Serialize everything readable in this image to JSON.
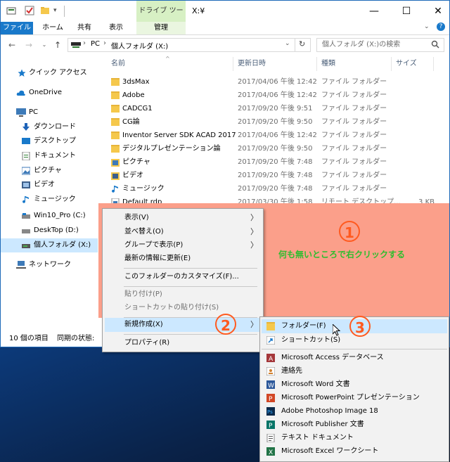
{
  "window": {
    "title": "X:¥",
    "context_tab_header": "ドライブ ツール",
    "minimize": "—",
    "maximize": "☐",
    "close": "✕"
  },
  "ribbon": {
    "tabs": [
      "ファイル",
      "ホーム",
      "共有",
      "表示",
      "管理"
    ]
  },
  "address": {
    "path": [
      "PC",
      "個人フォルダ (X:)"
    ],
    "sep": "›",
    "search_placeholder": "個人フォルダ (X:)の検索"
  },
  "nav": {
    "items": [
      {
        "label": "クイック アクセス",
        "icon": "star-icon"
      },
      {
        "label": "OneDrive",
        "icon": "cloud-icon"
      },
      {
        "label": "PC",
        "icon": "pc-icon"
      },
      {
        "label": "ダウンロード",
        "icon": "download-icon"
      },
      {
        "label": "デスクトップ",
        "icon": "desktop-icon"
      },
      {
        "label": "ドキュメント",
        "icon": "document-icon"
      },
      {
        "label": "ピクチャ",
        "icon": "picture-icon"
      },
      {
        "label": "ビデオ",
        "icon": "video-icon"
      },
      {
        "label": "ミュージック",
        "icon": "music-icon"
      },
      {
        "label": "Win10_Pro (C:)",
        "icon": "drive-icon"
      },
      {
        "label": "DeskTop (D:)",
        "icon": "drive-icon"
      },
      {
        "label": "個人フォルダ (X:)",
        "icon": "drive-icon"
      },
      {
        "label": "ネットワーク",
        "icon": "network-icon"
      }
    ]
  },
  "files": {
    "columns": [
      "名前",
      "更新日時",
      "種類",
      "サイズ"
    ],
    "rows": [
      {
        "name": "3dsMax",
        "date": "2017/04/06 午後 12:42",
        "type": "ファイル フォルダー",
        "size": "",
        "icon": "folder-icon"
      },
      {
        "name": "Adobe",
        "date": "2017/04/06 午後 12:42",
        "type": "ファイル フォルダー",
        "size": "",
        "icon": "folder-icon"
      },
      {
        "name": "CADCG1",
        "date": "2017/09/20 午後 9:51",
        "type": "ファイル フォルダー",
        "size": "",
        "icon": "folder-icon"
      },
      {
        "name": "CG論",
        "date": "2017/09/20 午後 9:50",
        "type": "ファイル フォルダー",
        "size": "",
        "icon": "folder-icon"
      },
      {
        "name": "Inventor Server SDK ACAD 2017",
        "date": "2017/04/06 午後 12:42",
        "type": "ファイル フォルダー",
        "size": "",
        "icon": "folder-icon"
      },
      {
        "name": "デジタルプレゼンテーション論",
        "date": "2017/09/20 午後 9:50",
        "type": "ファイル フォルダー",
        "size": "",
        "icon": "folder-icon"
      },
      {
        "name": "ピクチャ",
        "date": "2017/09/20 午後 7:48",
        "type": "ファイル フォルダー",
        "size": "",
        "icon": "picture-icon"
      },
      {
        "name": "ビデオ",
        "date": "2017/09/20 午後 7:48",
        "type": "ファイル フォルダー",
        "size": "",
        "icon": "video-icon"
      },
      {
        "name": "ミュージック",
        "date": "2017/09/20 午後 7:48",
        "type": "ファイル フォルダー",
        "size": "",
        "icon": "music-icon"
      },
      {
        "name": "Default.rdp",
        "date": "2017/03/30 午後 1:58",
        "type": "リモート デスクトップ...",
        "size": "3 KB",
        "icon": "rdp-icon"
      }
    ]
  },
  "status": {
    "count": "10 個の項目",
    "sync": "同期の状態:"
  },
  "annotations": {
    "step1": "1",
    "step2": "2",
    "step3": "3",
    "hint": "何も無いところで右クリックする",
    "color": "#ff5a1f",
    "hint_color": "#2ebd2e"
  },
  "context_menu": {
    "items": [
      {
        "label": "表示(V)",
        "submenu": true,
        "disabled": false
      },
      {
        "label": "並べ替え(O)",
        "submenu": true,
        "disabled": false
      },
      {
        "label": "グループで表示(P)",
        "submenu": true,
        "disabled": false
      },
      {
        "label": "最新の情報に更新(E)",
        "submenu": false,
        "disabled": false
      },
      {
        "label": "このフォルダーのカスタマイズ(F)...",
        "submenu": false,
        "disabled": false
      },
      {
        "label": "貼り付け(P)",
        "submenu": false,
        "disabled": true
      },
      {
        "label": "ショートカットの貼り付け(S)",
        "submenu": false,
        "disabled": true
      },
      {
        "label": "新規作成(X)",
        "submenu": true,
        "disabled": false
      },
      {
        "label": "プロパティ(R)",
        "submenu": false,
        "disabled": false
      }
    ]
  },
  "new_submenu": {
    "items": [
      {
        "label": "フォルダー(F)",
        "icon": "folder-icon"
      },
      {
        "label": "ショートカット(S)",
        "icon": "shortcut-icon"
      },
      {
        "label": "Microsoft Access データベース",
        "icon": "access-icon"
      },
      {
        "label": "連絡先",
        "icon": "contact-icon"
      },
      {
        "label": "Microsoft Word 文書",
        "icon": "word-icon"
      },
      {
        "label": "Microsoft PowerPoint プレゼンテーション",
        "icon": "powerpoint-icon"
      },
      {
        "label": "Adobe Photoshop Image 18",
        "icon": "photoshop-icon"
      },
      {
        "label": "Microsoft Publisher 文書",
        "icon": "publisher-icon"
      },
      {
        "label": "テキスト ドキュメント",
        "icon": "text-icon"
      },
      {
        "label": "Microsoft Excel ワークシート",
        "icon": "excel-icon"
      }
    ]
  }
}
